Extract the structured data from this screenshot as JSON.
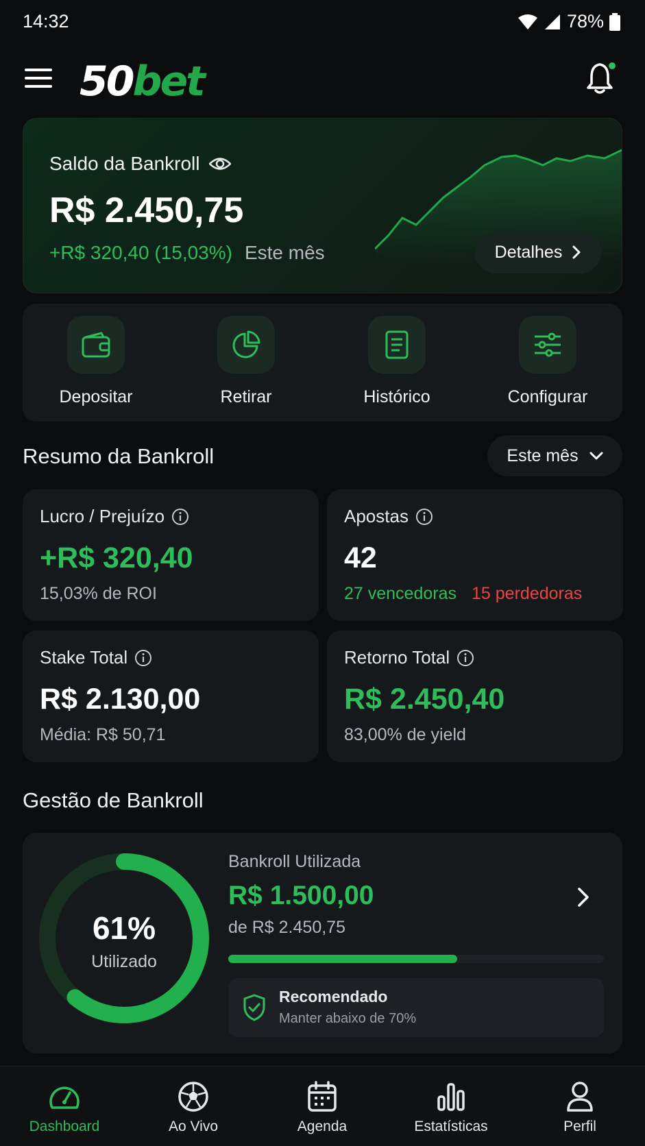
{
  "status_bar": {
    "time": "14:32",
    "battery": "78%"
  },
  "app": {
    "logo_main": "50",
    "logo_accent": "bet"
  },
  "balance": {
    "label": "Saldo da Bankroll",
    "amount": "R$ 2.450,75",
    "change": "+R$ 320,40 (15,03%)",
    "period": "Este mês",
    "details_label": "Detalhes"
  },
  "actions": [
    {
      "label": "Depositar",
      "icon": "wallet-icon"
    },
    {
      "label": "Retirar",
      "icon": "pie-chart-icon"
    },
    {
      "label": "Histórico",
      "icon": "document-icon"
    },
    {
      "label": "Configurar",
      "icon": "sliders-icon"
    }
  ],
  "summary": {
    "title": "Resumo da Bankroll",
    "period_select": "Este mês",
    "profit": {
      "label": "Lucro / Prejuízo",
      "value": "+R$ 320,40",
      "sub": "15,03% de ROI"
    },
    "bets": {
      "label": "Apostas",
      "value": "42",
      "wins": "27 vencedoras",
      "losses": "15 perdedoras"
    },
    "stake": {
      "label": "Stake Total",
      "value": "R$ 2.130,00",
      "sub": "Média: R$ 50,71"
    },
    "return": {
      "label": "Retorno Total",
      "value": "R$ 2.450,40",
      "sub": "83,00% de yield"
    }
  },
  "management": {
    "title": "Gestão de Bankroll",
    "percent_text": "61%",
    "percent_value": 61,
    "percent_label": "Utilizado",
    "used_label": "Bankroll Utilizada",
    "used_value": "R$ 1.500,00",
    "used_of": "de R$ 2.450,75",
    "recommendation_title": "Recomendado",
    "recommendation_sub": "Manter abaixo de 70%"
  },
  "nav": [
    {
      "label": "Dashboard",
      "icon": "gauge-icon",
      "active": true
    },
    {
      "label": "Ao Vivo",
      "icon": "soccer-ball-icon",
      "active": false
    },
    {
      "label": "Agenda",
      "icon": "calendar-icon",
      "active": false
    },
    {
      "label": "Estatísticas",
      "icon": "bar-chart-icon",
      "active": false
    },
    {
      "label": "Perfil",
      "icon": "user-icon",
      "active": false
    }
  ],
  "colors": {
    "accent": "#2ebd5a",
    "loss": "#e84545",
    "background": "#0b0c0e",
    "card": "#16191c"
  }
}
